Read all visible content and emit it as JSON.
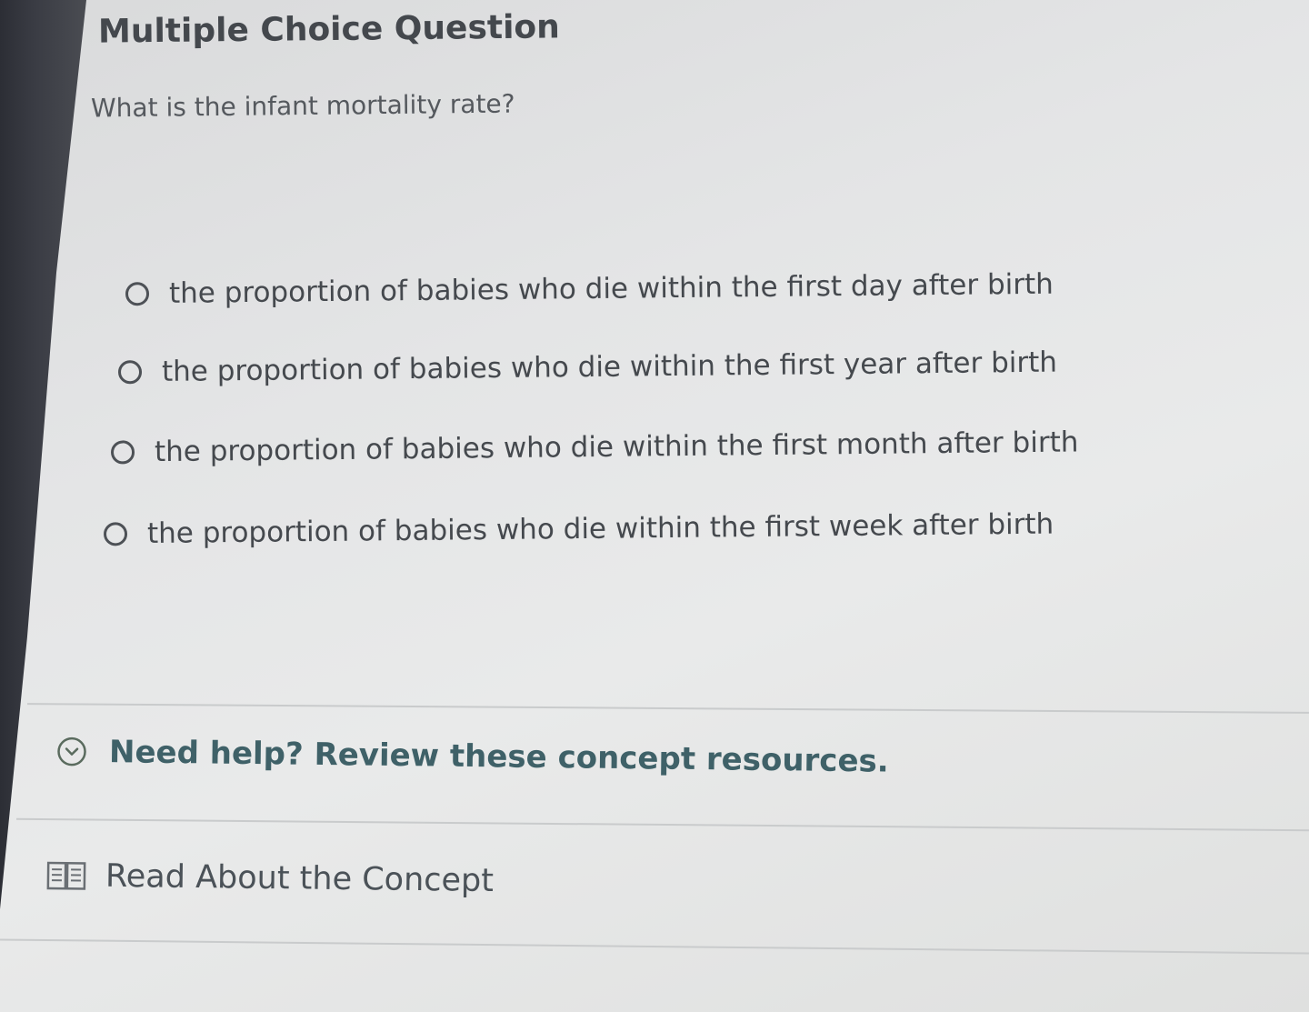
{
  "title": "Multiple Choice Question",
  "question": "What is the infant mortality rate?",
  "options": [
    {
      "label": "the proportion of babies who die within the first day after birth"
    },
    {
      "label": "the proportion of babies who die within the first year after birth"
    },
    {
      "label": "the proportion of babies who die within the first month after birth"
    },
    {
      "label": "the proportion of babies who die within the first week after birth"
    }
  ],
  "help": {
    "label": "Need help? Review these concept resources.",
    "icon": "chevron-down-circle-icon"
  },
  "resources": {
    "read_label": "Read About the Concept",
    "icon": "book-icon"
  },
  "colors": {
    "help_text": "#3f6168",
    "body_text": "#45494e",
    "background": "#e4e5e6"
  }
}
